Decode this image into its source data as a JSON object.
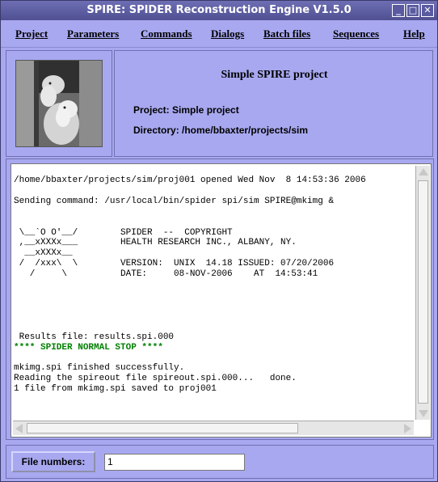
{
  "window": {
    "title": "SPIRE: SPIDER Reconstruction Engine V1.5.0",
    "controls": [
      "_",
      "□",
      "✕"
    ]
  },
  "menu": {
    "items": [
      {
        "label": "Project"
      },
      {
        "label": "Parameters"
      },
      {
        "label": "Commands"
      },
      {
        "label": "Dialogs"
      },
      {
        "label": "Batch files"
      },
      {
        "label": "Sequences"
      },
      {
        "label": "Help"
      }
    ]
  },
  "header": {
    "project_title": "Simple SPIRE project",
    "project_line": "Project: Simple project",
    "directory_line": "Directory: /home/bbaxter/projects/sim",
    "image": "sheep-photo"
  },
  "log": {
    "lines": [
      "/home/bbaxter/projects/sim/proj001 opened Wed Nov  8 14:53:36 2006",
      "",
      "Sending command: /usr/local/bin/spider spi/sim SPIRE@mkimg &",
      "",
      "",
      " \\__`O O'__/        SPIDER  --  COPYRIGHT",
      " ,__xXXXx___        HEALTH RESEARCH INC., ALBANY, NY.",
      "  __xXXXx__",
      " /  /xxx\\  \\        VERSION:  UNIX  14.18 ISSUED: 07/20/2006",
      "   /     \\          DATE:     08-NOV-2006    AT  14:53:41",
      "",
      "",
      "",
      "",
      "",
      " Results file: results.spi.000"
    ],
    "stop_line": "**** SPIDER NORMAL STOP ****",
    "tail_lines": [
      "",
      "mkimg.spi finished successfully.",
      "Reading the spireout file spireout.spi.000...   done.",
      "1 file from mkimg.spi saved to proj001"
    ]
  },
  "bottom": {
    "file_numbers_label": "File numbers:",
    "file_numbers_value": "1"
  },
  "colors": {
    "background": "#a8a8f0",
    "stop_text": "#008000"
  }
}
